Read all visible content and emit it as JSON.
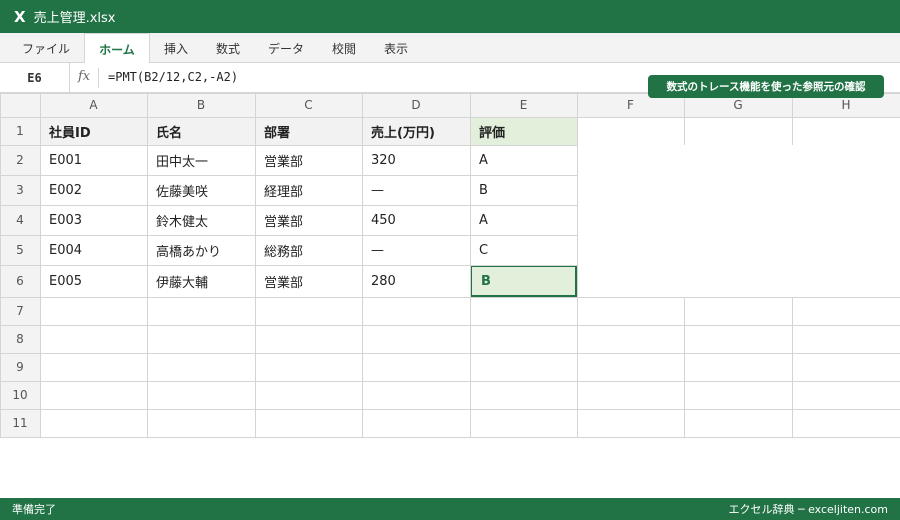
{
  "window": {
    "icon": "X",
    "filename": "売上管理.xlsx"
  },
  "ribbon": {
    "tabs": [
      "ファイル",
      "ホーム",
      "挿入",
      "数式",
      "データ",
      "校閲",
      "表示"
    ],
    "active": "ホーム"
  },
  "formula_bar": {
    "cell_ref": "E6",
    "fx_label": "fx",
    "formula": "=PMT(B2/12,C2,-A2)"
  },
  "callout": "数式のトレース機能を使った参照元の確認",
  "sheet": {
    "columns": [
      "A",
      "B",
      "C",
      "D",
      "E",
      "F",
      "G",
      "H"
    ],
    "rows": [
      "1",
      "2",
      "3",
      "4",
      "5",
      "6",
      "7",
      "8",
      "9",
      "10",
      "11"
    ],
    "header": [
      "社員ID",
      "氏名",
      "部署",
      "売上(万円)",
      "評価"
    ],
    "data": [
      [
        "E001",
        "田中太一",
        "営業部",
        "320",
        "A"
      ],
      [
        "E002",
        "佐藤美咲",
        "経理部",
        "—",
        "B"
      ],
      [
        "E003",
        "鈴木健太",
        "営業部",
        "450",
        "A"
      ],
      [
        "E004",
        "高橋あかり",
        "総務部",
        "—",
        "C"
      ],
      [
        "E005",
        "伊藤大輔",
        "営業部",
        "280",
        "B"
      ]
    ]
  },
  "status": {
    "left": "準備完了",
    "right": "エクセル辞典 ─ exceljiten.com"
  },
  "colors": {
    "brand": "#217346",
    "highlight": "#e2efda"
  }
}
